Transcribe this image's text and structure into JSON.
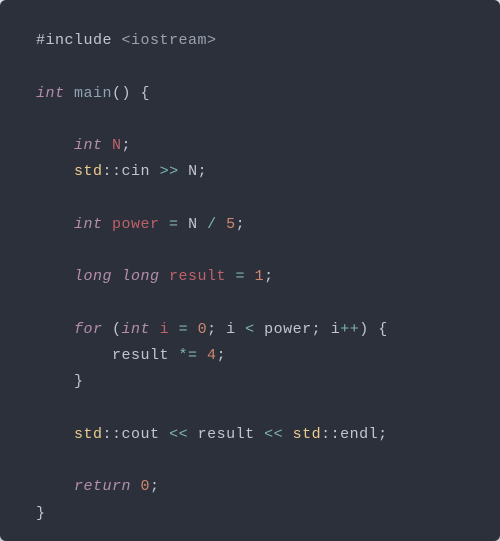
{
  "code": {
    "lines": [
      {
        "indent": 0,
        "tokens": [
          [
            "preproc",
            "#include "
          ],
          [
            "preproc-bracket",
            "<iostream>"
          ]
        ]
      },
      {
        "indent": 0,
        "tokens": []
      },
      {
        "indent": 0,
        "tokens": [
          [
            "type",
            "int "
          ],
          [
            "func",
            "main"
          ],
          [
            "paren",
            "()"
          ],
          [
            "punct",
            " {"
          ]
        ]
      },
      {
        "indent": 0,
        "tokens": []
      },
      {
        "indent": 1,
        "tokens": [
          [
            "type",
            "int "
          ],
          [
            "var",
            "N"
          ],
          [
            "punct",
            ";"
          ]
        ]
      },
      {
        "indent": 1,
        "tokens": [
          [
            "ns",
            "std"
          ],
          [
            "scope",
            "::"
          ],
          [
            "ident",
            "cin"
          ],
          [
            "op",
            " >> "
          ],
          [
            "ident",
            "N"
          ],
          [
            "punct",
            ";"
          ]
        ]
      },
      {
        "indent": 0,
        "tokens": []
      },
      {
        "indent": 1,
        "tokens": [
          [
            "type",
            "int "
          ],
          [
            "var",
            "power"
          ],
          [
            "op",
            " = "
          ],
          [
            "ident",
            "N"
          ],
          [
            "op",
            " / "
          ],
          [
            "num",
            "5"
          ],
          [
            "punct",
            ";"
          ]
        ]
      },
      {
        "indent": 0,
        "tokens": []
      },
      {
        "indent": 1,
        "tokens": [
          [
            "type",
            "long long "
          ],
          [
            "var",
            "result"
          ],
          [
            "op",
            " = "
          ],
          [
            "num",
            "1"
          ],
          [
            "punct",
            ";"
          ]
        ]
      },
      {
        "indent": 0,
        "tokens": []
      },
      {
        "indent": 1,
        "tokens": [
          [
            "keyword",
            "for "
          ],
          [
            "paren",
            "("
          ],
          [
            "type",
            "int "
          ],
          [
            "var",
            "i"
          ],
          [
            "op",
            " = "
          ],
          [
            "num",
            "0"
          ],
          [
            "punct",
            "; "
          ],
          [
            "ident",
            "i"
          ],
          [
            "op",
            " < "
          ],
          [
            "ident",
            "power"
          ],
          [
            "punct",
            "; "
          ],
          [
            "ident",
            "i"
          ],
          [
            "op",
            "++"
          ],
          [
            "paren",
            ")"
          ],
          [
            "punct",
            " {"
          ]
        ]
      },
      {
        "indent": 2,
        "tokens": [
          [
            "ident",
            "result"
          ],
          [
            "op",
            " *= "
          ],
          [
            "num",
            "4"
          ],
          [
            "punct",
            ";"
          ]
        ]
      },
      {
        "indent": 1,
        "tokens": [
          [
            "punct",
            "}"
          ]
        ]
      },
      {
        "indent": 0,
        "tokens": []
      },
      {
        "indent": 1,
        "tokens": [
          [
            "ns",
            "std"
          ],
          [
            "scope",
            "::"
          ],
          [
            "ident",
            "cout"
          ],
          [
            "op",
            " << "
          ],
          [
            "ident",
            "result"
          ],
          [
            "op",
            " << "
          ],
          [
            "ns",
            "std"
          ],
          [
            "scope",
            "::"
          ],
          [
            "ident",
            "endl"
          ],
          [
            "punct",
            ";"
          ]
        ]
      },
      {
        "indent": 0,
        "tokens": []
      },
      {
        "indent": 1,
        "tokens": [
          [
            "keyword",
            "return "
          ],
          [
            "num",
            "0"
          ],
          [
            "punct",
            ";"
          ]
        ]
      },
      {
        "indent": 0,
        "tokens": [
          [
            "punct",
            "}"
          ]
        ]
      }
    ]
  }
}
